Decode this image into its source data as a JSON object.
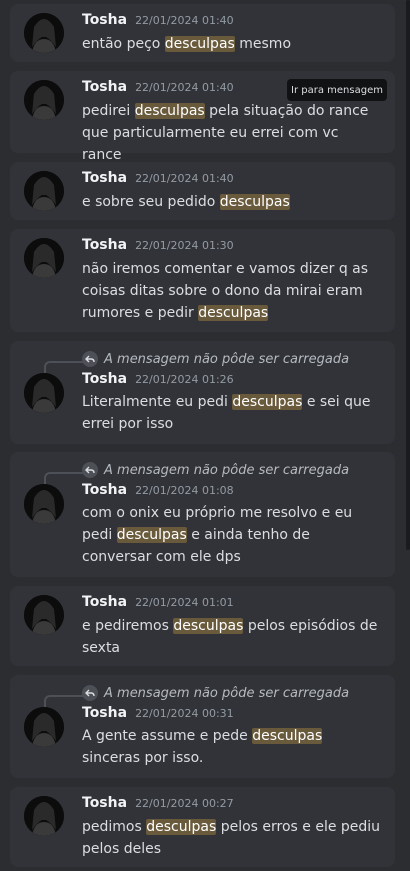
{
  "reply": {
    "unavailable_text": "A mensagem não pôde ser carregada"
  },
  "tooltip": {
    "jump_label": "Ir para mensagem"
  },
  "results": [
    {
      "author": "Tosha",
      "timestamp": "22/01/2024 01:40",
      "content": [
        {
          "t": "então peço "
        },
        {
          "t": "desculpas",
          "hl": true
        },
        {
          "t": " mesmo"
        }
      ]
    },
    {
      "author": "Tosha",
      "timestamp": "22/01/2024 01:40",
      "content": [
        {
          "t": "pedirei "
        },
        {
          "t": "desculpas",
          "hl": true
        },
        {
          "t": " pela situação do rance que particularmente eu errei com vc rance"
        }
      ]
    },
    {
      "author": "Tosha",
      "timestamp": "22/01/2024 01:40",
      "content": [
        {
          "t": "e sobre seu pedido "
        },
        {
          "t": "desculpas",
          "hl": true
        }
      ]
    },
    {
      "author": "Tosha",
      "timestamp": "22/01/2024 01:30",
      "content": [
        {
          "t": "não iremos comentar e vamos dizer q as coisas ditas sobre o dono da mirai eram rumores e pedir "
        },
        {
          "t": "desculpas",
          "hl": true
        }
      ]
    },
    {
      "author": "Tosha",
      "timestamp": "22/01/2024 01:26",
      "content": [
        {
          "t": "Literalmente eu pedi "
        },
        {
          "t": "desculpas",
          "hl": true
        },
        {
          "t": " e sei que errei por isso"
        }
      ]
    },
    {
      "author": "Tosha",
      "timestamp": "22/01/2024 01:08",
      "content": [
        {
          "t": "com o onix eu próprio me resolvo e eu pedi "
        },
        {
          "t": "desculpas",
          "hl": true
        },
        {
          "t": " e ainda tenho de conversar com ele dps"
        }
      ]
    },
    {
      "author": "Tosha",
      "timestamp": "22/01/2024 01:01",
      "content": [
        {
          "t": "e pediremos "
        },
        {
          "t": "desculpas",
          "hl": true
        },
        {
          "t": " pelos episódios de sexta"
        }
      ]
    },
    {
      "author": "Tosha",
      "timestamp": "22/01/2024 00:31",
      "content": [
        {
          "t": "A gente assume e pede "
        },
        {
          "t": "desculpas",
          "hl": true
        },
        {
          "t": " sinceras por isso."
        }
      ]
    },
    {
      "author": "Tosha",
      "timestamp": "22/01/2024 00:27",
      "content": [
        {
          "t": "pedimos "
        },
        {
          "t": "desculpas",
          "hl": true
        },
        {
          "t": " pelos erros e ele pediu pelos deles"
        }
      ]
    }
  ]
}
